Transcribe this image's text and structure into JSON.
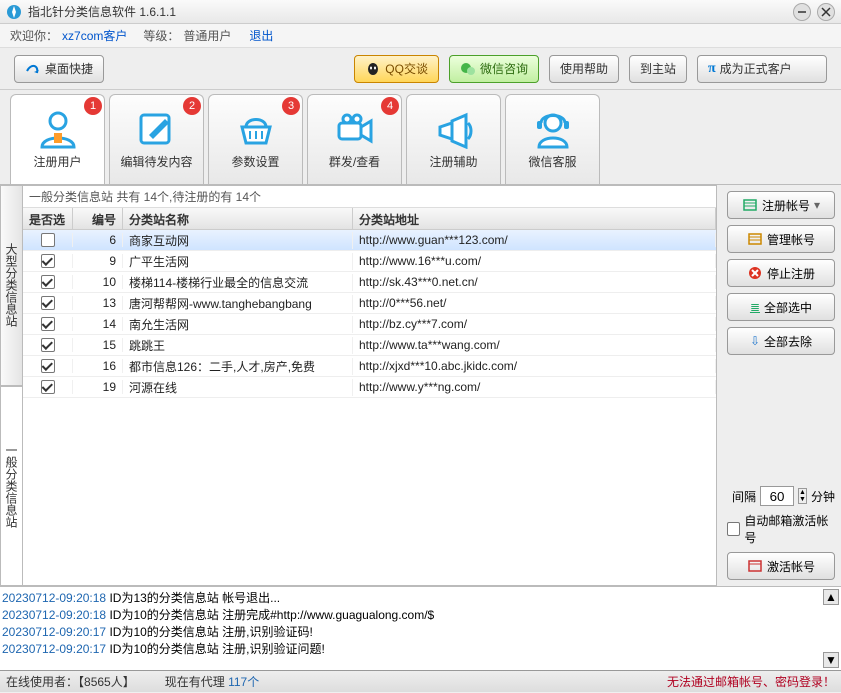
{
  "titlebar": {
    "title": "指北针分类信息软件 1.6.1.1"
  },
  "userbar": {
    "welcome": "欢迎你：",
    "username": "xz7com客户",
    "level_lbl": "等级：",
    "level_val": "普通用户",
    "logout": "退出"
  },
  "topbtns": {
    "desktop": "桌面快捷",
    "qq": "QQ交谈",
    "wechat": "微信咨询",
    "help": "使用帮助",
    "mainsite": "到主站",
    "upgrade": "成为正式客户"
  },
  "tabs": [
    {
      "label": "注册用户",
      "badge": "1"
    },
    {
      "label": "编辑待发内容",
      "badge": "2"
    },
    {
      "label": "参数设置",
      "badge": "3"
    },
    {
      "label": "群发/查看",
      "badge": "4"
    },
    {
      "label": "注册辅助",
      "badge": ""
    },
    {
      "label": "微信客服",
      "badge": ""
    }
  ],
  "sidetabs": {
    "big": "大型分类信息站",
    "gen": "一般分类信息站"
  },
  "panel": {
    "summary": "一般分类信息站 共有 14个,待注册的有 14个",
    "cols": {
      "sel": "是否选中",
      "idx": "编号",
      "name": "分类站名称",
      "url": "分类站地址"
    },
    "rows": [
      {
        "checked": false,
        "idx": "6",
        "name": "商家互动网",
        "url": "http://www.guan***123.com/",
        "selected": true
      },
      {
        "checked": true,
        "idx": "9",
        "name": "广平生活网",
        "url": "http://www.16***u.com/"
      },
      {
        "checked": true,
        "idx": "10",
        "name": "楼梯114-楼梯行业最全的信息交流",
        "url": "http://sk.43***0.net.cn/"
      },
      {
        "checked": true,
        "idx": "13",
        "name": "唐河帮帮网-www.tanghebangbang",
        "url": "http://0***56.net/"
      },
      {
        "checked": true,
        "idx": "14",
        "name": "南允生活网",
        "url": "http://bz.cy***7.com/"
      },
      {
        "checked": true,
        "idx": "15",
        "name": "跳跳王",
        "url": "http://www.ta***wang.com/"
      },
      {
        "checked": true,
        "idx": "16",
        "name": "都市信息126：二手,人才,房产,免费",
        "url": "http://xjxd***10.abc.jkidc.com/"
      },
      {
        "checked": true,
        "idx": "19",
        "name": "河源在线",
        "url": "http://www.y***ng.com/"
      }
    ]
  },
  "rcol": {
    "reg": "注册帐号",
    "manage": "管理帐号",
    "stop": "停止注册",
    "selall": "全部选中",
    "deselall": "全部去除",
    "interval_lbl": "间隔",
    "interval_val": "60",
    "interval_unit": "分钟",
    "autoactivate": "自动邮箱激活帐号",
    "activate": "激活帐号"
  },
  "log": [
    {
      "ts": "20230712-09:20:18",
      "msg": "ID为13的分类信息站 帐号退出..."
    },
    {
      "ts": "20230712-09:20:18",
      "msg": "ID为10的分类信息站 注册完成#http://www.guagualong.com/$"
    },
    {
      "ts": "20230712-09:20:17",
      "msg": "ID为10的分类信息站 注册,识别验证码!"
    },
    {
      "ts": "20230712-09:20:17",
      "msg": "ID为10的分类信息站 注册,识别验证问题!"
    }
  ],
  "status": {
    "online_lbl": "在线使用者：",
    "online_val": "【8565人】",
    "agent_lbl": "现在有代理 ",
    "agent_val": "117个",
    "error": "无法通过邮箱帐号、密码登录！"
  }
}
